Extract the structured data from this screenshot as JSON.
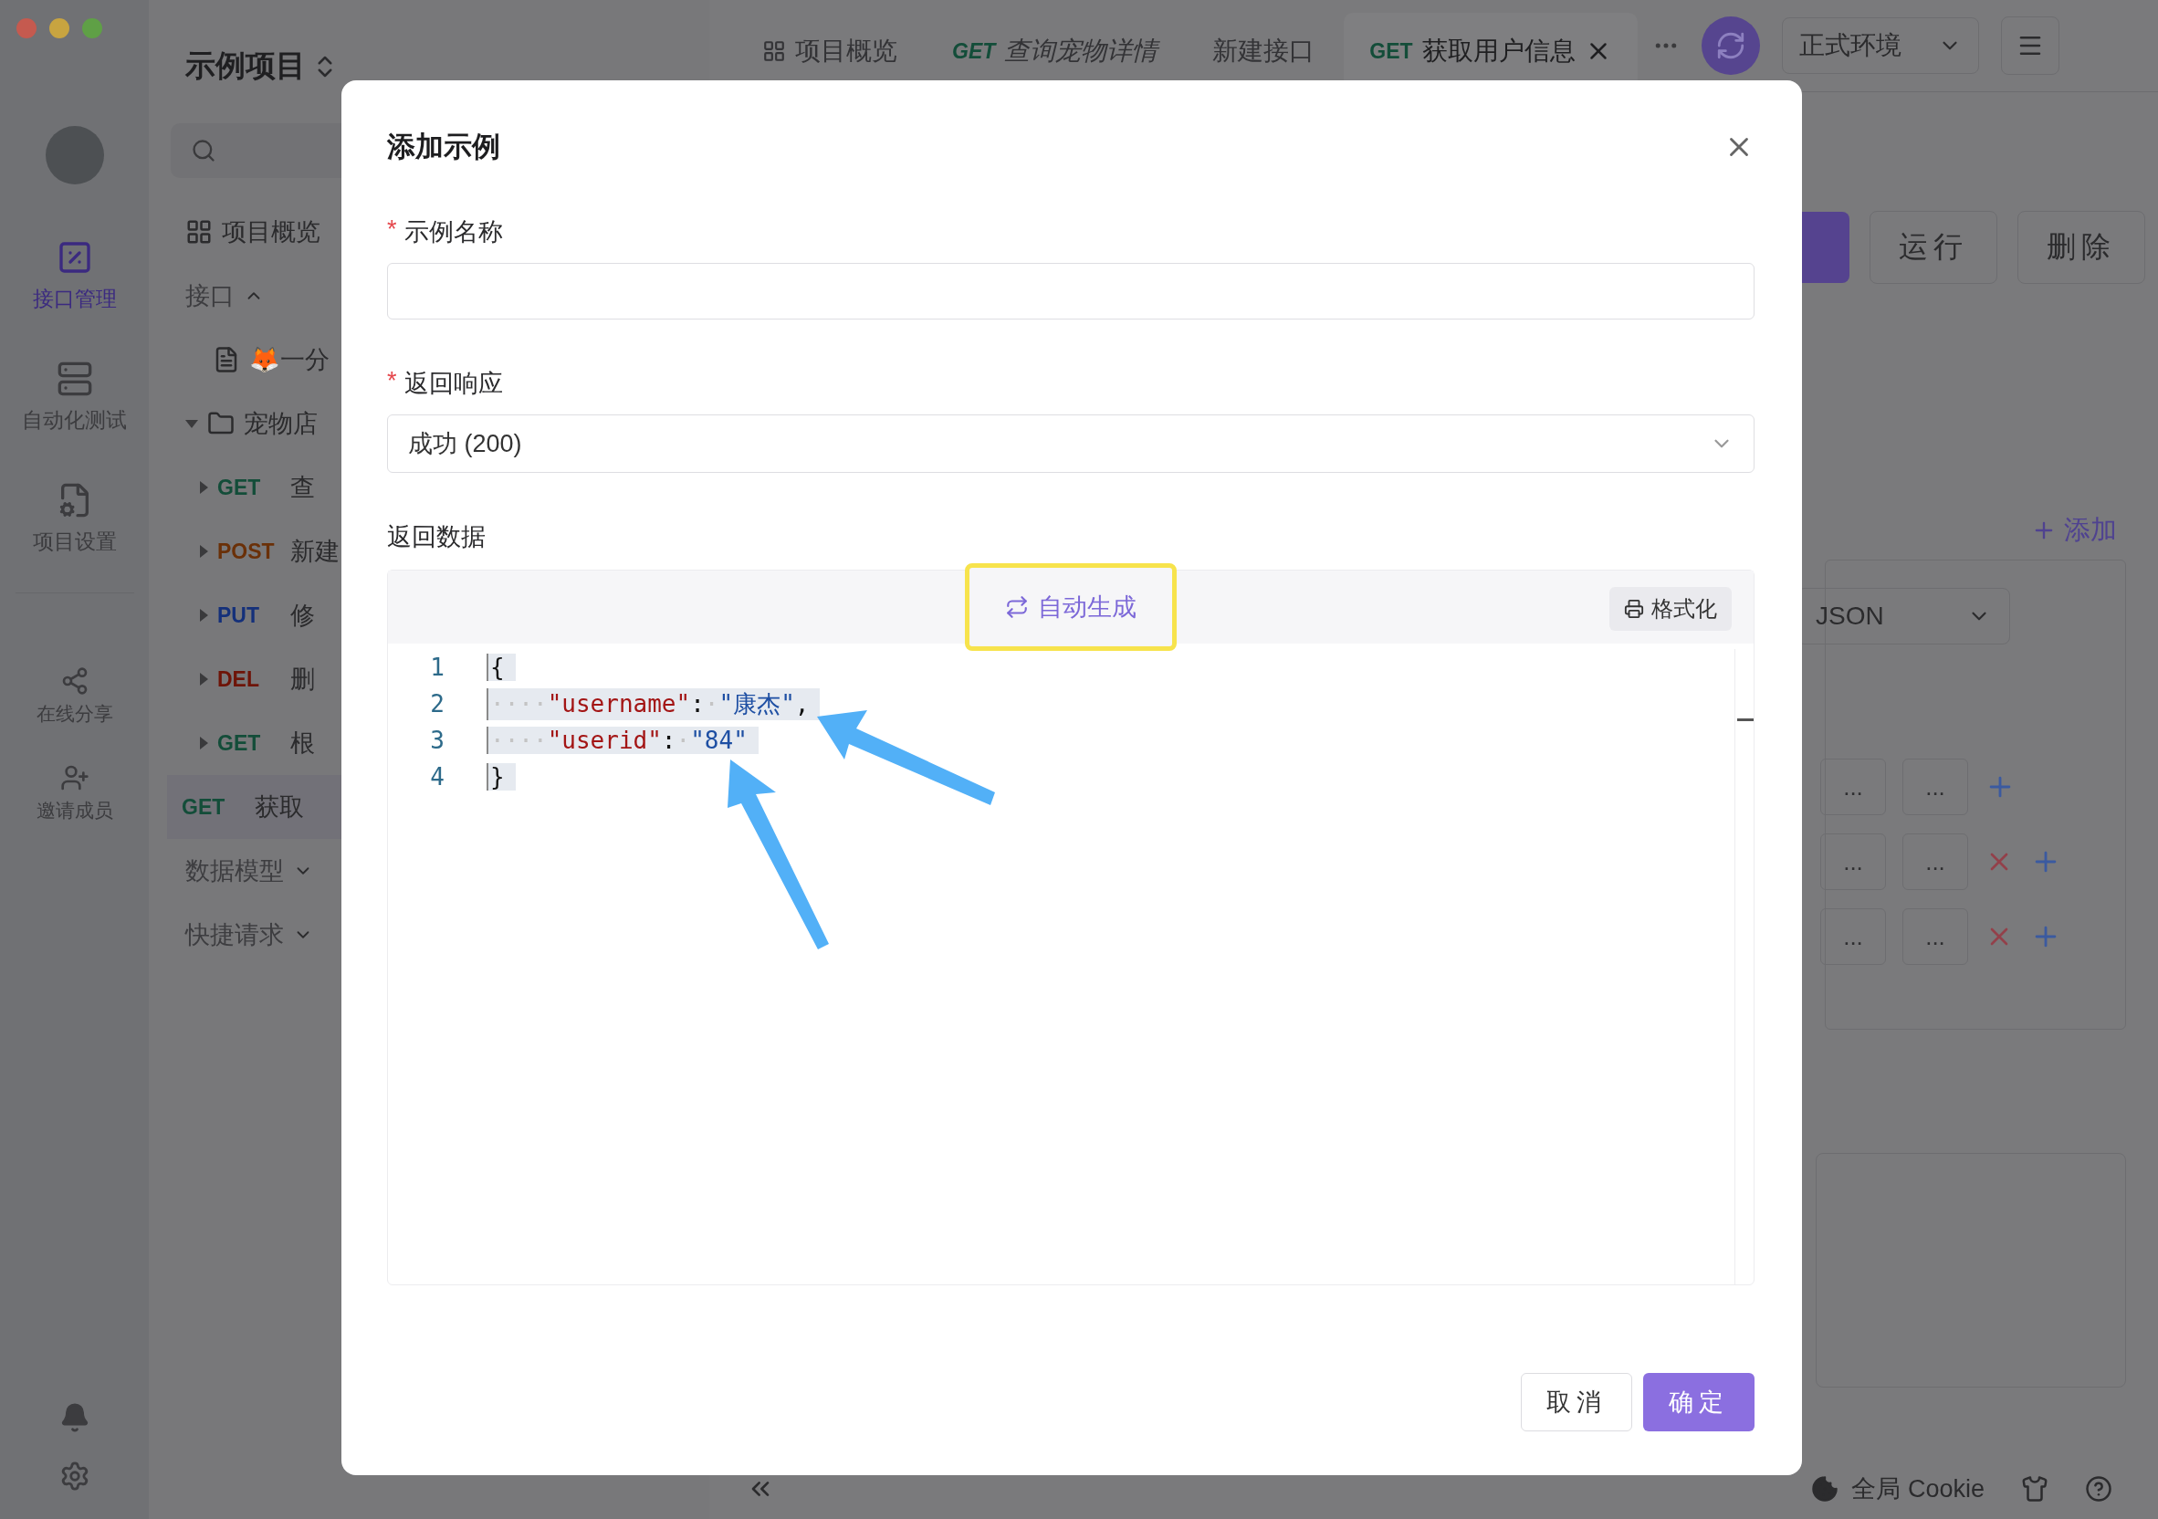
{
  "project": {
    "title": "示例项目"
  },
  "rail": {
    "items": [
      {
        "kind": "api",
        "label": "接口管理",
        "selected": true
      },
      {
        "kind": "auto",
        "label": "自动化测试",
        "selected": false
      },
      {
        "kind": "settings",
        "label": "项目设置",
        "selected": false
      }
    ],
    "extras": [
      {
        "kind": "share",
        "label": "在线分享"
      },
      {
        "kind": "invite",
        "label": "邀请成员"
      }
    ]
  },
  "sidebar": {
    "overview": "项目概览",
    "tree": [
      {
        "label": "接口",
        "expanded": true,
        "children": [
          {
            "kind": "doc",
            "label": "🦊一分"
          },
          {
            "kind": "folder",
            "label": "宠物店",
            "expanded": true,
            "children": [
              {
                "method": "GET",
                "label": "查",
                "expandable": true,
                "selected": false
              },
              {
                "method": "POST",
                "label": "新建",
                "expandable": true,
                "selected": false
              },
              {
                "method": "PUT",
                "label": "修",
                "expandable": true,
                "selected": false
              },
              {
                "method": "DEL",
                "label": "删",
                "expandable": true,
                "selected": false
              },
              {
                "method": "GET",
                "label": "根",
                "expandable": true,
                "selected": false
              },
              {
                "method": "GET",
                "label": "获取",
                "expandable": false,
                "selected": true
              }
            ]
          }
        ]
      },
      {
        "label": "数据模型",
        "expanded": false
      },
      {
        "label": "快捷请求",
        "expanded": false
      }
    ]
  },
  "tabs": [
    {
      "kind": "overview",
      "label": "项目概览",
      "preview": false,
      "selected": false
    },
    {
      "kind": "request",
      "method": "GET",
      "label": "查询宠物详情",
      "preview": true,
      "selected": false
    },
    {
      "kind": "plain",
      "label": "新建接口",
      "preview": false,
      "selected": false
    },
    {
      "kind": "request",
      "method": "GET",
      "label": "获取用户信息",
      "preview": false,
      "selected": true
    }
  ],
  "environment": "正式环境",
  "panel": {
    "buttons": [
      "运行",
      "删除"
    ],
    "add": "添加",
    "body_type": "JSON",
    "rows": [
      {
        "cells": [
          "...",
          "..."
        ],
        "removable": false
      },
      {
        "cells": [
          "...",
          "..."
        ],
        "removable": true
      },
      {
        "cells": [
          "...",
          "..."
        ],
        "removable": true
      }
    ]
  },
  "status_bar": {
    "cookie": "全局 Cookie"
  },
  "dialog": {
    "title": "添加示例",
    "name_field": {
      "label": "示例名称",
      "marker": "*"
    },
    "response_field": {
      "label": "返回响应",
      "marker": "*",
      "value": "成功 (200)"
    },
    "data": {
      "label": "返回数据",
      "generate": "自动生成",
      "format": "格式化",
      "lines": [
        {
          "number": "1",
          "selected": true,
          "tokens": [
            {
              "kind": "punct",
              "text": "{"
            }
          ]
        },
        {
          "number": "2",
          "selected": true,
          "tokens": [
            {
              "kind": "indent",
              "text": "····"
            },
            {
              "kind": "key",
              "text": "\"username\""
            },
            {
              "kind": "punct",
              "text": ":"
            },
            {
              "kind": "indent",
              "text": "·"
            },
            {
              "kind": "string",
              "text": "\"康杰\""
            },
            {
              "kind": "punct",
              "text": ","
            }
          ]
        },
        {
          "number": "3",
          "selected": true,
          "tokens": [
            {
              "kind": "indent",
              "text": "····"
            },
            {
              "kind": "key",
              "text": "\"userid\""
            },
            {
              "kind": "punct",
              "text": ":"
            },
            {
              "kind": "indent",
              "text": "·"
            },
            {
              "kind": "string",
              "text": "\"84\""
            }
          ]
        },
        {
          "number": "4",
          "selected": true,
          "tokens": [
            {
              "kind": "punct",
              "text": "}"
            }
          ]
        }
      ]
    },
    "buttons": {
      "cancel": "取消",
      "ok": "确定"
    }
  }
}
